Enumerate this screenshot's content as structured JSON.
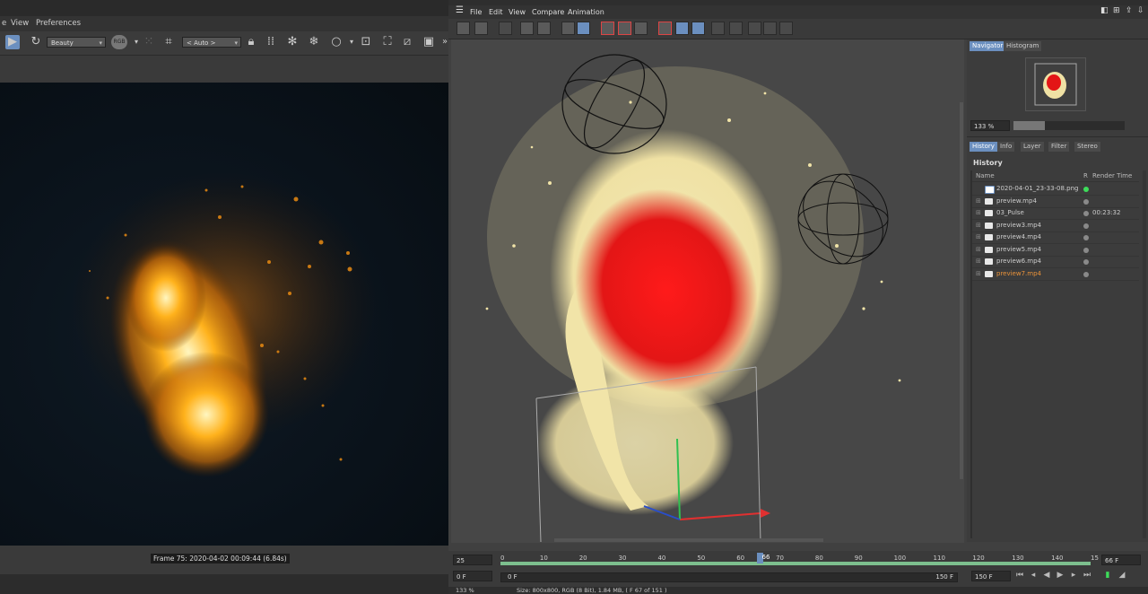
{
  "left_window": {
    "menu": [
      "e",
      "View",
      "Preferences"
    ],
    "render_pass": "Beauty",
    "channel": "RGB",
    "region": "< Auto >",
    "frame_label": "Frame 75: 2020-04-02 00:09:44 (6.84s)"
  },
  "picture_viewer": {
    "menu": [
      "File",
      "Edit",
      "View",
      "Compare",
      "Animation"
    ],
    "navigator": {
      "tabs": [
        "Navigator",
        "Histogram"
      ],
      "zoom": "133 %",
      "zoom_fraction": 0.28
    },
    "panel_tabs": [
      "History",
      "Info",
      "Layer",
      "Filter",
      "Stereo"
    ],
    "history": {
      "title": "History",
      "columns": {
        "name": "Name",
        "r": "R",
        "render_time": "Render Time"
      },
      "items": [
        {
          "name": "2020-04-01_23-33-08.png",
          "status": "green",
          "time": ""
        },
        {
          "name": "preview.mp4",
          "status": "grey",
          "time": ""
        },
        {
          "name": "03_Pulse",
          "status": "grey",
          "time": "00:23:32"
        },
        {
          "name": "preview3.mp4",
          "status": "grey",
          "time": ""
        },
        {
          "name": "preview4.mp4",
          "status": "grey",
          "time": ""
        },
        {
          "name": "preview5.mp4",
          "status": "grey",
          "time": ""
        },
        {
          "name": "preview6.mp4",
          "status": "grey",
          "time": ""
        },
        {
          "name": "preview7.mp4",
          "status": "grey",
          "time": "",
          "active": true
        }
      ]
    },
    "timeline": {
      "fps": "25",
      "start": "0 F",
      "range_start": "0 F",
      "range_end": "150 F",
      "end": "150 F",
      "current": "66 F",
      "current_marker": "66",
      "ticks": [
        "0",
        "10",
        "20",
        "30",
        "40",
        "50",
        "60",
        "70",
        "80",
        "90",
        "100",
        "110",
        "120",
        "130",
        "140",
        "15"
      ]
    },
    "status": {
      "zoom": "133 %",
      "info": "Size: 800x800, RGB (8 Bit), 1.84 MB,  ( F 67 of 151 )"
    }
  },
  "colors": {
    "accent": "#6b8fbf",
    "history_active": "#e8923a",
    "status_green": "#3ddc5a",
    "fire": "#f5a623",
    "red_blob": "#e01a1a",
    "cream": "#f2e7b0"
  },
  "icons": [
    "play-icon",
    "refresh-icon",
    "crop-icon",
    "lock-icon",
    "grid-icon",
    "snowflake-icon",
    "circle-icon",
    "folder-icon",
    "save-icon"
  ]
}
